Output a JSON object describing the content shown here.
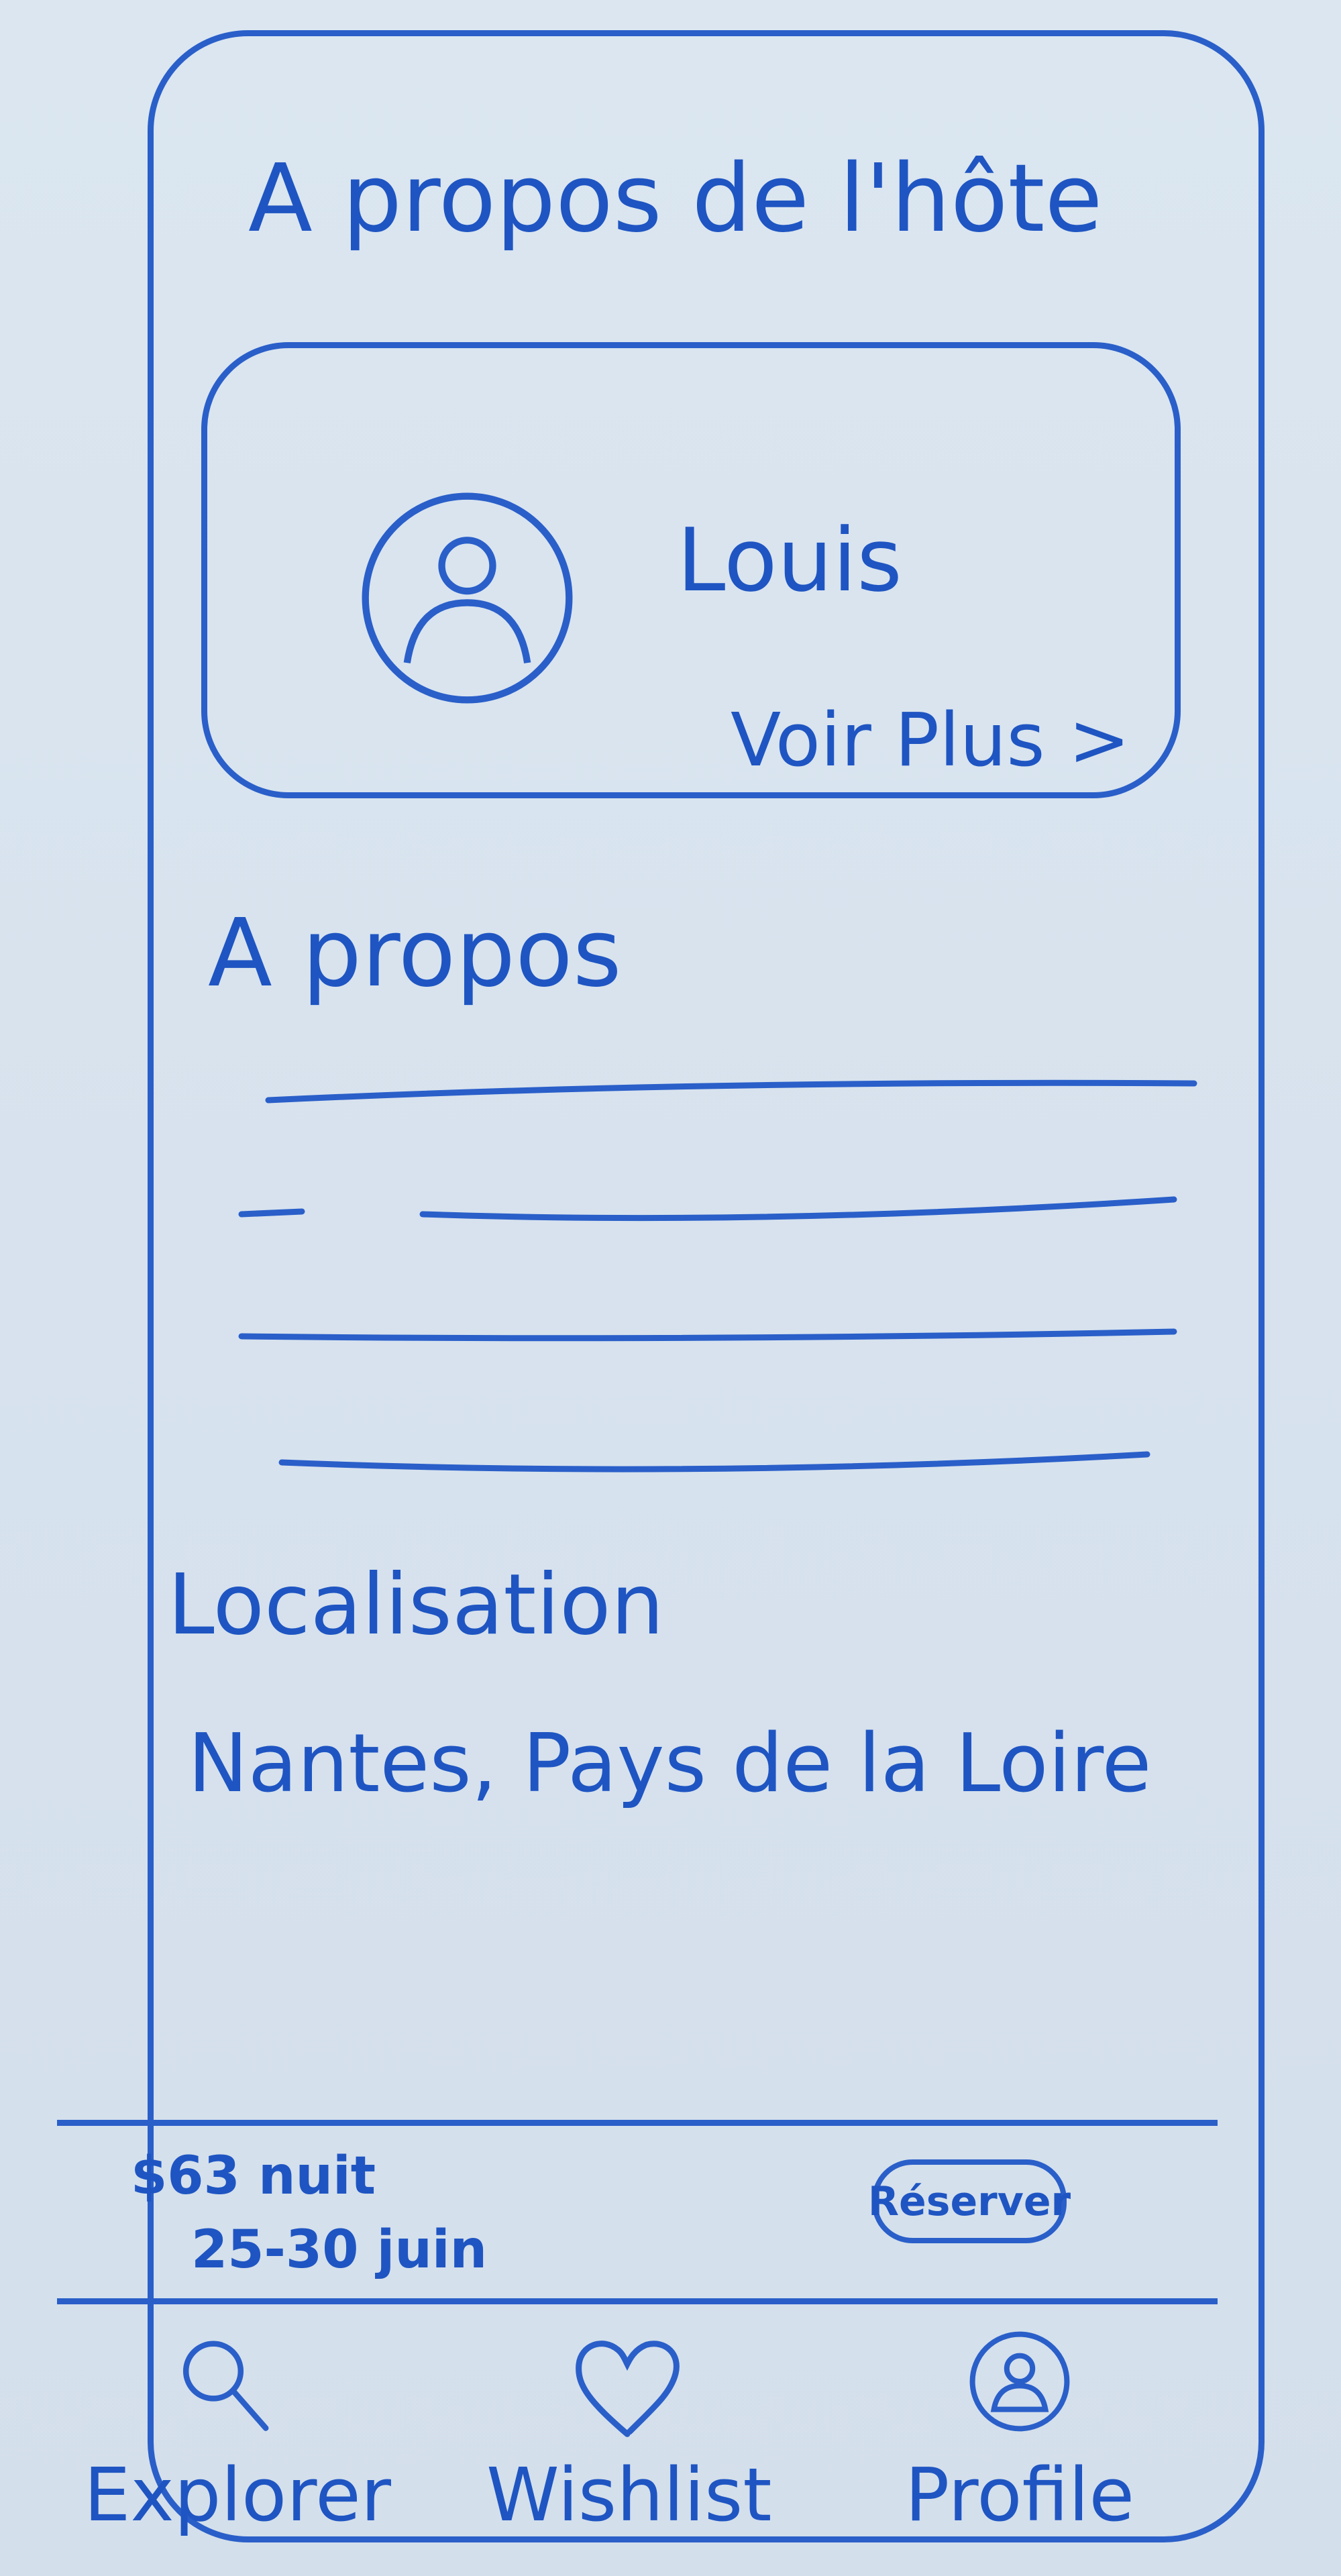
{
  "header": {
    "title": "A propos de l'hôte"
  },
  "host_card": {
    "name": "Louis",
    "see_more": "Voir Plus >",
    "avatar_icon": "user-avatar-icon"
  },
  "about": {
    "title": "A propos"
  },
  "location": {
    "title": "Localisation",
    "value": "Nantes, Pays de la Loire"
  },
  "booking": {
    "price": "$63 nuit",
    "dates": "25-30 juin",
    "reserve_label": "Réserver"
  },
  "tabs": [
    {
      "label": "Explorer",
      "icon": "search-icon"
    },
    {
      "label": "Wishlist",
      "icon": "heart-icon"
    },
    {
      "label": "Profile",
      "icon": "user-avatar-icon"
    }
  ],
  "colors": {
    "ink": "#1f55c2",
    "paper": "#d9e4ef"
  }
}
